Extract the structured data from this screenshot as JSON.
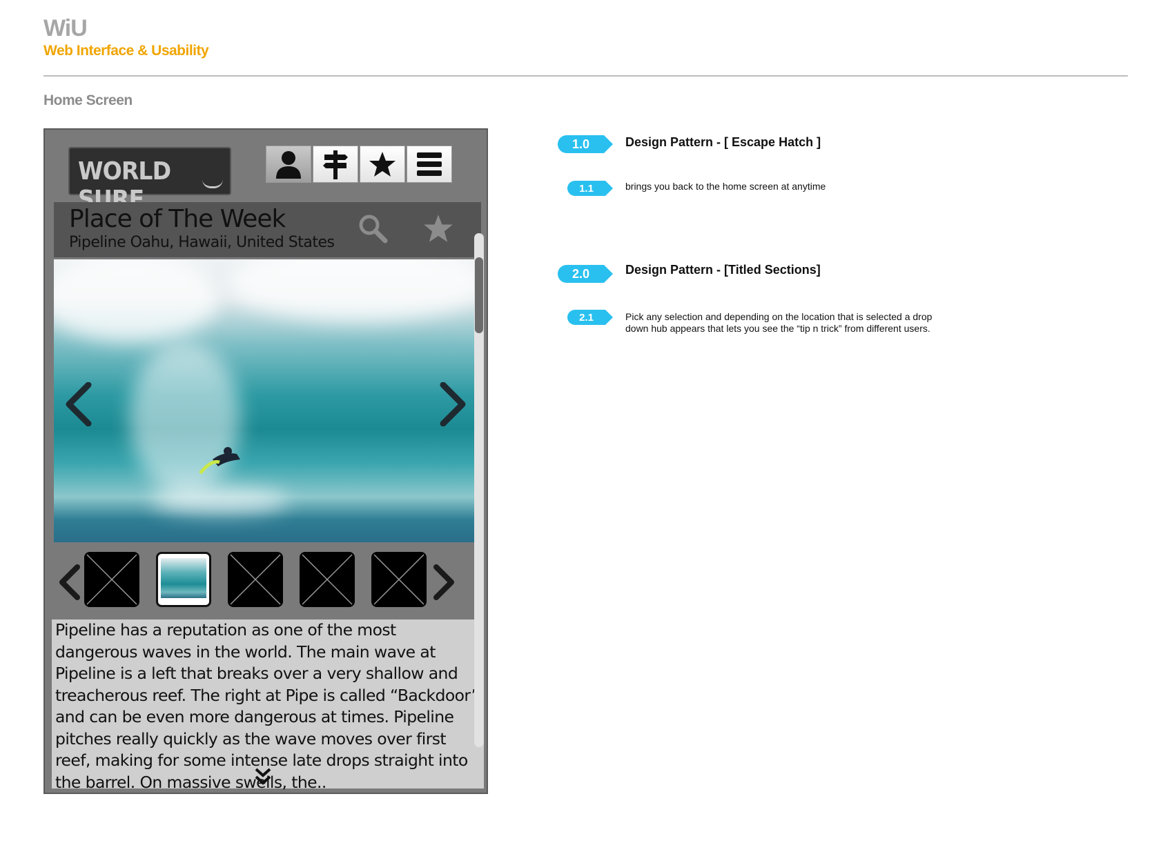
{
  "header": {
    "brand": "WiU",
    "subtitle": "Web Interface & Usability",
    "section_title": "Home Screen",
    "accent_color": "#f0a500"
  },
  "app": {
    "logo_text": "WORLD SURF",
    "nav_icons": [
      "user-icon",
      "signpost-icon",
      "star-icon",
      "menu-icon"
    ],
    "feature": {
      "title": "Place of The Week",
      "location": "Pipeline Oahu, Hawaii, United States"
    },
    "thumbnails_count_selected_index": 1,
    "description": "Pipeline has a reputation as one of the most dangerous waves in the world. The main wave at Pipeline is a left that breaks over a very shallow and treacherous reef. The right at Pipe is called “Backdoor” and can be even more dangerous at times. Pipeline pitches really quickly as the wave moves over first reef, making for some intense late drops straight into the barrel. On massive swells, the.."
  },
  "annotations": [
    {
      "number": "1.0",
      "heading": "Design Pattern - [ Escape Hatch ]"
    },
    {
      "number": "1.1",
      "text": "brings you back to the home screen at anytime"
    },
    {
      "number": "2.0",
      "heading": "Design Pattern - [Titled Sections]"
    },
    {
      "number": "2.1",
      "text": "Pick any selection and depending on the location that is selected a drop down hub appears that lets you see the “tip n trick” from different users."
    }
  ],
  "colors": {
    "tag": "#29c0ef"
  }
}
